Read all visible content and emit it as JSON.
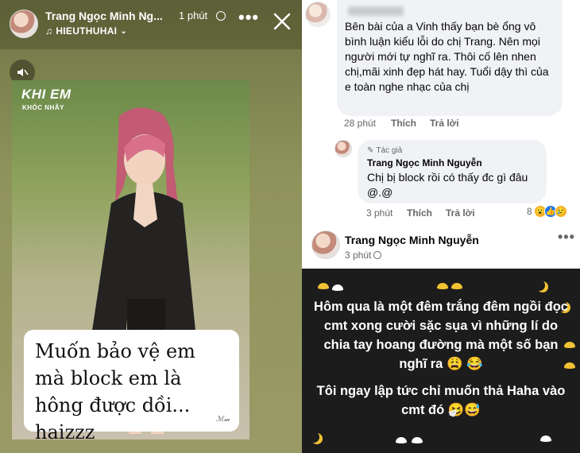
{
  "story": {
    "author": "Trang Ngọc Minh Ng...",
    "time": "1 phút",
    "music": "HIEUTHUHAI",
    "card_title": "KHI EM",
    "card_subtitle": "KHÓC NHÃY",
    "caption": "Muốn bảo vệ em mà block em là hông được dồi... haizzz"
  },
  "comments": {
    "c1": {
      "text": "Bên bài của a Vinh thấy bạn bè ổng vô bình luận kiểu lỗi do chị Trang. Nên mọi người mới tự nghĩ ra. Thôi cố lên nhen chị,mãi xinh đẹp hát hay. Tuổi dậy thì của e toàn nghe nhạc của chị",
      "time": "28 phút",
      "like": "Thích",
      "reply": "Trả lời"
    },
    "r1": {
      "badge": "Tác giả",
      "author": "Trang Ngọc Minh Nguyễn",
      "text": "Chị bị block rồi có thấy đc gì đâu @.@",
      "time": "3 phút",
      "like": "Thích",
      "reply": "Trả lời",
      "reaction_count": "8"
    }
  },
  "post": {
    "author": "Trang Ngọc Minh Nguyễn",
    "time": "3 phút",
    "line1": "Hôm qua là một đêm trắng đêm ngồi đọc cmt xong cười sặc sụa vì những lí do chia tay hoang đường mà một số bạn nghĩ ra 😩 😂",
    "line2": "Tôi ngay lập tức chỉ muốn thả Haha vào cmt đó 🤧😅"
  },
  "colors": {
    "story_bg": "#8b8f5a",
    "bubble_bg": "#f0f2f5",
    "meta_text": "#65676b",
    "post_bg": "#1c1c1c",
    "accent_yellow": "#f1c232"
  }
}
